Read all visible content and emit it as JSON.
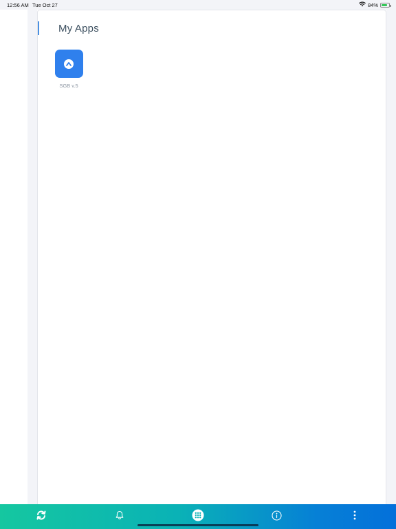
{
  "status_bar": {
    "time": "12:56 AM",
    "date": "Tue Oct 27",
    "battery_percent": "84%",
    "battery_level": 0.84,
    "icons": [
      "wifi-icon",
      "battery-charging-icon"
    ]
  },
  "main": {
    "title": "My Apps",
    "apps": [
      {
        "label": "SGB v.5",
        "icon": "app-caret-icon"
      }
    ]
  },
  "bottom_nav": {
    "items": [
      {
        "icon": "refresh-sync-icon"
      },
      {
        "icon": "bell-icon"
      },
      {
        "icon": "grid-apps-icon"
      },
      {
        "icon": "info-icon"
      },
      {
        "icon": "more-vertical-icon"
      }
    ]
  },
  "colors": {
    "accent": "#4a90e2",
    "app_icon": "#2f80ed",
    "bottom_bar_start": "#15c7a0",
    "bottom_bar_end": "#0470da",
    "battery": "#34c759"
  }
}
